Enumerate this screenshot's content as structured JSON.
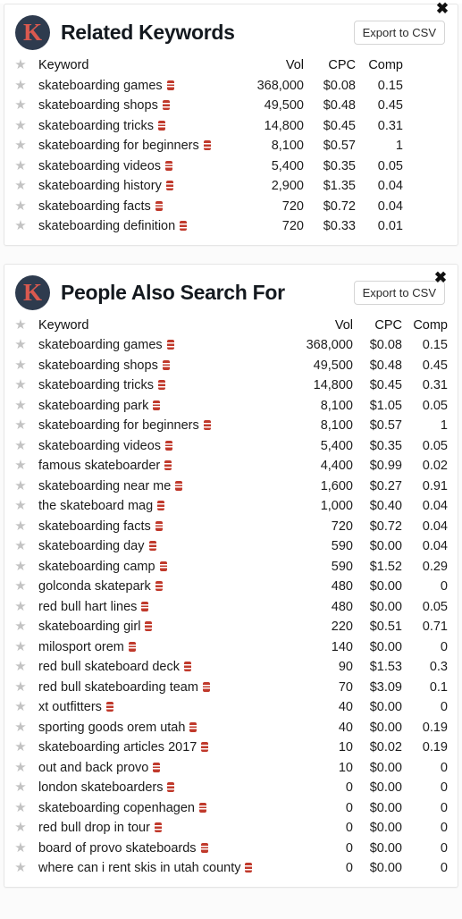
{
  "panels": [
    {
      "id": "related-keywords",
      "logo_letter": "K",
      "title": "Related Keywords",
      "export_label": "Export to CSV",
      "close_label": "✖",
      "columns": {
        "keyword": "Keyword",
        "vol": "Vol",
        "cpc": "CPC",
        "comp": "Comp"
      },
      "rows": [
        {
          "keyword": "skateboarding games",
          "vol": "368,000",
          "cpc": "$0.08",
          "comp": "0.15"
        },
        {
          "keyword": "skateboarding shops",
          "vol": "49,500",
          "cpc": "$0.48",
          "comp": "0.45"
        },
        {
          "keyword": "skateboarding tricks",
          "vol": "14,800",
          "cpc": "$0.45",
          "comp": "0.31"
        },
        {
          "keyword": "skateboarding for beginners",
          "vol": "8,100",
          "cpc": "$0.57",
          "comp": "1"
        },
        {
          "keyword": "skateboarding videos",
          "vol": "5,400",
          "cpc": "$0.35",
          "comp": "0.05"
        },
        {
          "keyword": "skateboarding history",
          "vol": "2,900",
          "cpc": "$1.35",
          "comp": "0.04"
        },
        {
          "keyword": "skateboarding facts",
          "vol": "720",
          "cpc": "$0.72",
          "comp": "0.04"
        },
        {
          "keyword": "skateboarding definition",
          "vol": "720",
          "cpc": "$0.33",
          "comp": "0.01"
        }
      ]
    },
    {
      "id": "people-also-search-for",
      "logo_letter": "K",
      "title": "People Also Search For",
      "export_label": "Export to CSV",
      "close_label": "✖",
      "columns": {
        "keyword": "Keyword",
        "vol": "Vol",
        "cpc": "CPC",
        "comp": "Comp"
      },
      "rows": [
        {
          "keyword": "skateboarding games",
          "vol": "368,000",
          "cpc": "$0.08",
          "comp": "0.15"
        },
        {
          "keyword": "skateboarding shops",
          "vol": "49,500",
          "cpc": "$0.48",
          "comp": "0.45"
        },
        {
          "keyword": "skateboarding tricks",
          "vol": "14,800",
          "cpc": "$0.45",
          "comp": "0.31"
        },
        {
          "keyword": "skateboarding park",
          "vol": "8,100",
          "cpc": "$1.05",
          "comp": "0.05"
        },
        {
          "keyword": "skateboarding for beginners",
          "vol": "8,100",
          "cpc": "$0.57",
          "comp": "1"
        },
        {
          "keyword": "skateboarding videos",
          "vol": "5,400",
          "cpc": "$0.35",
          "comp": "0.05"
        },
        {
          "keyword": "famous skateboarder",
          "vol": "4,400",
          "cpc": "$0.99",
          "comp": "0.02"
        },
        {
          "keyword": "skateboarding near me",
          "vol": "1,600",
          "cpc": "$0.27",
          "comp": "0.91"
        },
        {
          "keyword": "the skateboard mag",
          "vol": "1,000",
          "cpc": "$0.40",
          "comp": "0.04"
        },
        {
          "keyword": "skateboarding facts",
          "vol": "720",
          "cpc": "$0.72",
          "comp": "0.04"
        },
        {
          "keyword": "skateboarding day",
          "vol": "590",
          "cpc": "$0.00",
          "comp": "0.04"
        },
        {
          "keyword": "skateboarding camp",
          "vol": "590",
          "cpc": "$1.52",
          "comp": "0.29"
        },
        {
          "keyword": "golconda skatepark",
          "vol": "480",
          "cpc": "$0.00",
          "comp": "0"
        },
        {
          "keyword": "red bull hart lines",
          "vol": "480",
          "cpc": "$0.00",
          "comp": "0.05"
        },
        {
          "keyword": "skateboarding girl",
          "vol": "220",
          "cpc": "$0.51",
          "comp": "0.71"
        },
        {
          "keyword": "milosport orem",
          "vol": "140",
          "cpc": "$0.00",
          "comp": "0"
        },
        {
          "keyword": "red bull skateboard deck",
          "vol": "90",
          "cpc": "$1.53",
          "comp": "0.3"
        },
        {
          "keyword": "red bull skateboarding team",
          "vol": "70",
          "cpc": "$3.09",
          "comp": "0.1"
        },
        {
          "keyword": "xt outfitters",
          "vol": "40",
          "cpc": "$0.00",
          "comp": "0"
        },
        {
          "keyword": "sporting goods orem utah",
          "vol": "40",
          "cpc": "$0.00",
          "comp": "0.19"
        },
        {
          "keyword": "skateboarding articles 2017",
          "vol": "10",
          "cpc": "$0.02",
          "comp": "0.19"
        },
        {
          "keyword": "out and back provo",
          "vol": "10",
          "cpc": "$0.00",
          "comp": "0"
        },
        {
          "keyword": "london skateboarders",
          "vol": "0",
          "cpc": "$0.00",
          "comp": "0"
        },
        {
          "keyword": "skateboarding copenhagen",
          "vol": "0",
          "cpc": "$0.00",
          "comp": "0"
        },
        {
          "keyword": "red bull drop in tour",
          "vol": "0",
          "cpc": "$0.00",
          "comp": "0"
        },
        {
          "keyword": "board of provo skateboards",
          "vol": "0",
          "cpc": "$0.00",
          "comp": "0"
        },
        {
          "keyword": "where can i rent skis in utah county",
          "vol": "0",
          "cpc": "$0.00",
          "comp": "0"
        }
      ]
    }
  ],
  "icons": {
    "star": "★",
    "stack": "stack-icon"
  },
  "colors": {
    "logo_bg": "#2e3b4e",
    "logo_fg": "#d9594f",
    "stack_icon": "#c0392b",
    "star": "#c3c3c3",
    "page_bg": "#fbfbfb"
  }
}
